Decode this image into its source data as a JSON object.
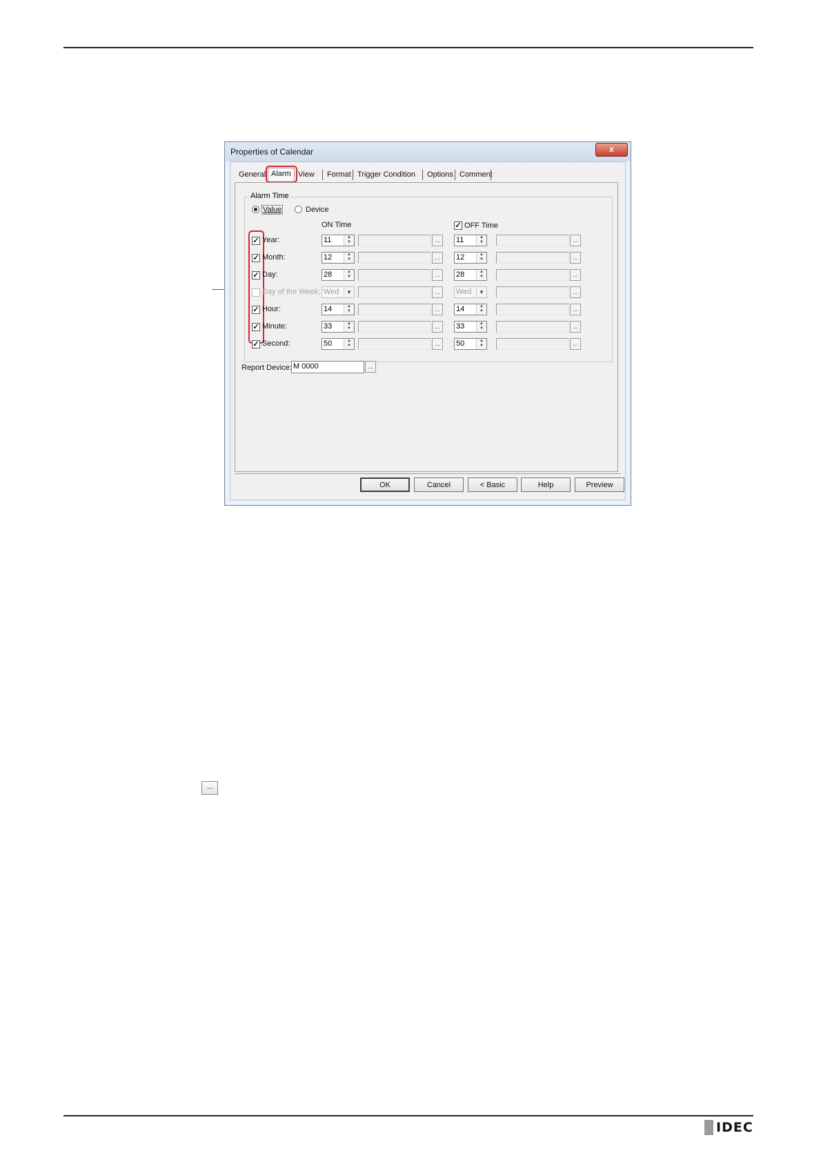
{
  "dialog": {
    "title": "Properties of Calendar",
    "close_glyph": "x",
    "tabs": [
      "General",
      "Alarm",
      "View",
      "Format",
      "Trigger Condition",
      "Options",
      "Comment"
    ],
    "active_tab": "Alarm",
    "group_label": "Alarm Time",
    "radio_value": "Value",
    "radio_device": "Device",
    "on_time_header": "ON Time",
    "off_time_header": "OFF Time",
    "rows": [
      {
        "label": "Year:",
        "on": "11",
        "off": "11",
        "checked": true,
        "enabled": true
      },
      {
        "label": "Month:",
        "on": "12",
        "off": "12",
        "checked": true,
        "enabled": true
      },
      {
        "label": "Day:",
        "on": "28",
        "off": "28",
        "checked": true,
        "enabled": true
      },
      {
        "label": "Day of the Week:",
        "on": "Wed",
        "off": "Wed",
        "checked": false,
        "enabled": false
      },
      {
        "label": "Hour:",
        "on": "14",
        "off": "14",
        "checked": true,
        "enabled": true
      },
      {
        "label": "Minute:",
        "on": "33",
        "off": "33",
        "checked": true,
        "enabled": true
      },
      {
        "label": "Second:",
        "on": "50",
        "off": "50",
        "checked": true,
        "enabled": true
      }
    ],
    "report_device_label": "Report Device:",
    "report_device_value": "M 0000",
    "browse_glyph": "...",
    "buttons": {
      "ok": "OK",
      "cancel": "Cancel",
      "basic": "< Basic",
      "help": "Help",
      "preview": "Preview"
    }
  },
  "loose_button_glyph": "...",
  "footer_logo": "IDEC"
}
